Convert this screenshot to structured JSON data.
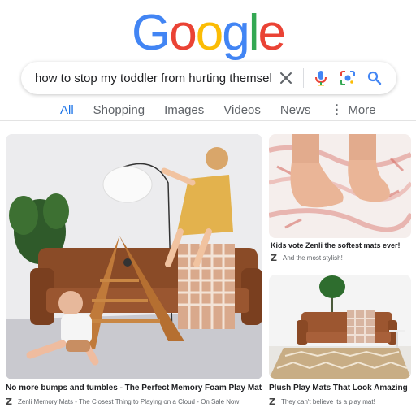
{
  "logo": {
    "letters": [
      "G",
      "o",
      "o",
      "g",
      "l",
      "e"
    ]
  },
  "colors": {
    "blue": "#4285F4",
    "red": "#EA4335",
    "yellow": "#FBBC05",
    "green": "#34A853",
    "accent": "#1a73e8"
  },
  "search": {
    "query": "how to stop my toddler from hurting themselves",
    "icons": [
      "close-icon",
      "microphone-icon",
      "lens-icon",
      "search-icon"
    ]
  },
  "tabs": [
    {
      "label": "All",
      "active": true
    },
    {
      "label": "Shopping"
    },
    {
      "label": "Images"
    },
    {
      "label": "Videos"
    },
    {
      "label": "News"
    },
    {
      "label": "More",
      "icon": "more-vert-icon"
    }
  ],
  "results": [
    {
      "title": "No more bumps and tumbles - The Perfect Memory Foam Play Mat",
      "source_logo": "Z",
      "source_text": "Zenli Memory Mats - The Closest Thing to Playing on a Cloud - On Sale Now!"
    },
    {
      "title": "Kids vote Zenli the softest mats ever!",
      "source_logo": "Z",
      "source_text": "And the most stylish!"
    },
    {
      "title": "Plush Play Mats That Look Amazing",
      "source_logo": "Z",
      "source_text": "They can't believe its a play mat!"
    }
  ]
}
